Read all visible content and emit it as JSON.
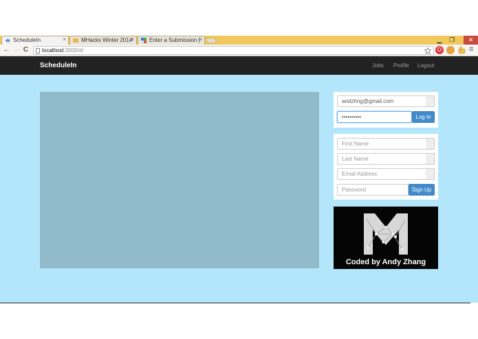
{
  "browser": {
    "tabs": [
      {
        "label": "ScheduleIn",
        "close": "×"
      },
      {
        "label": "MHacks Winter 2014",
        "close": "×"
      },
      {
        "label": "Enter a Submission |",
        "close": "×"
      }
    ],
    "url_host": "localhost",
    "url_rest": ":3000/#/",
    "window_buttons": {
      "minimize": "▁",
      "maximize": "❐",
      "close": "✕"
    },
    "nav_icons": {
      "back": "←",
      "forward": "→",
      "reload": "C"
    },
    "menu_icon": "≡"
  },
  "app": {
    "brand": "ScheduleIn",
    "nav": {
      "jobs": "Jobs",
      "profile": "Profile",
      "logout": "Logout"
    }
  },
  "login": {
    "email_value": "andzhng@gmail.com",
    "password_value": "••••••••••",
    "submit": "Log In"
  },
  "signup": {
    "first_name_placeholder": "First Name",
    "last_name_placeholder": "Last Name",
    "email_placeholder": "Email Address",
    "password_placeholder": "Password",
    "submit": "Sign Up"
  },
  "logo": {
    "caption": "Coded by Andy Zhang",
    "letter": "M"
  },
  "colors": {
    "navbar": "#222222",
    "background": "#b4e6fb",
    "primary_button": "#428bca",
    "media_placeholder": "#91bacb"
  }
}
